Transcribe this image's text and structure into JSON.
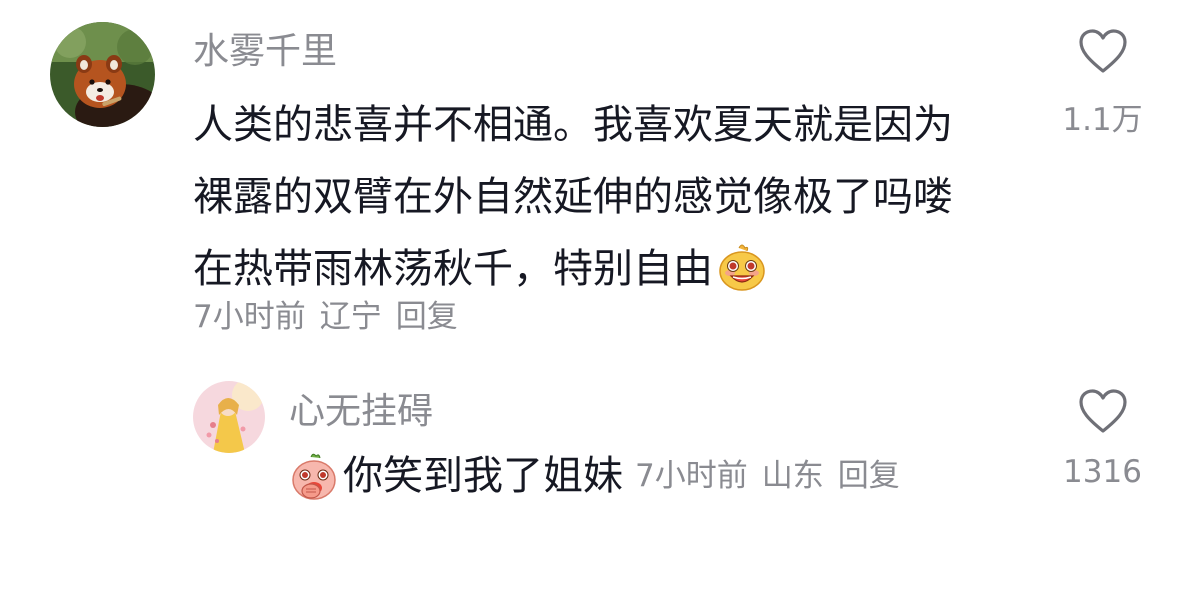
{
  "comments": [
    {
      "username": "水雾千里",
      "lines": [
        "人类的悲喜并不相通。我喜欢夏天就是因为",
        "裸露的双臂在外自然延伸的感觉像极了吗喽",
        "在热带雨林荡秋千，特别自由"
      ],
      "time": "7小时前",
      "location": "辽宁",
      "reply_label": "回复",
      "like_count": "1.1万",
      "avatar_icon": "red-panda-avatar",
      "emoji_icon": "grinning-face-emoji"
    },
    {
      "username": "心无挂碍",
      "text": "你笑到我了姐妹",
      "time": "7小时前",
      "location": "山东",
      "reply_label": "回复",
      "like_count": "1316",
      "avatar_icon": "illustrated-girl-avatar",
      "emoji_icon": "covering-mouth-laugh-emoji"
    }
  ],
  "colors": {
    "primary_text": "#161823",
    "secondary_text": "#8a8b91"
  }
}
